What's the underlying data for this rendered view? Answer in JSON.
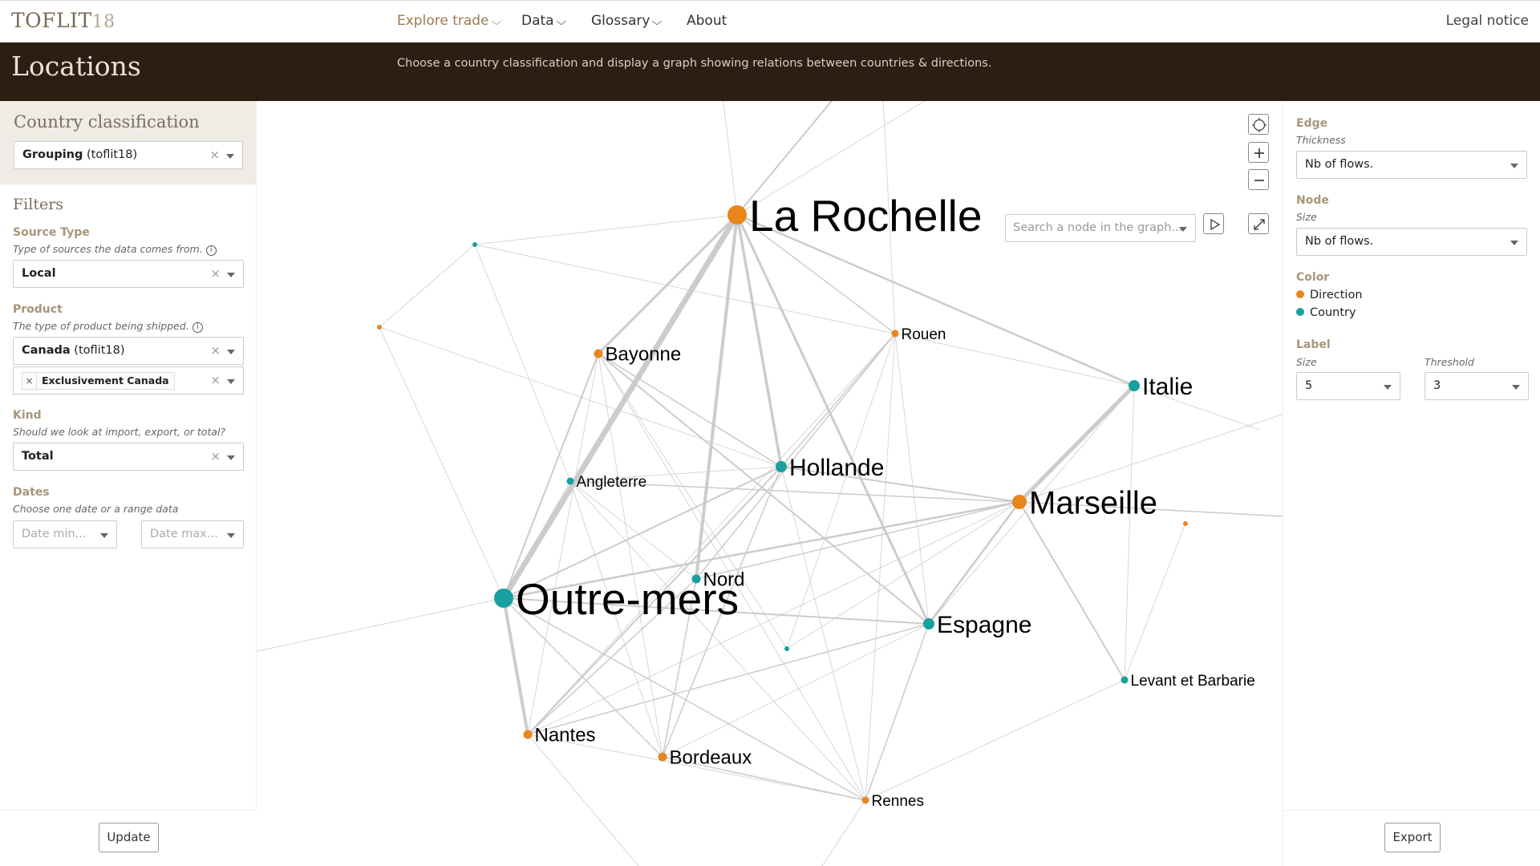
{
  "nav": {
    "logo_main": "TOFLIT",
    "logo_suffix": "18",
    "items": [
      {
        "label": "Explore trade"
      },
      {
        "label": "Data"
      },
      {
        "label": "Glossary"
      },
      {
        "label": "About"
      }
    ],
    "legal": "Legal notice"
  },
  "header": {
    "title": "Locations",
    "description": "Choose a country classification and display a graph showing relations between countries & directions."
  },
  "left": {
    "classification_title": "Country classification",
    "classification_value_bold": "Grouping",
    "classification_value_rest": " (toflit18)",
    "filters_title": "Filters",
    "source_type": {
      "label": "Source Type",
      "help": "Type of sources the data comes from.",
      "value": "Local"
    },
    "product": {
      "label": "Product",
      "help": "The type of product being shipped.",
      "value_bold": "Canada",
      "value_rest": " (toflit18)",
      "tag": "Exclusivement Canada"
    },
    "kind": {
      "label": "Kind",
      "help": "Should we look at import, export, or total?",
      "value": "Total"
    },
    "dates": {
      "label": "Dates",
      "help": "Choose one date or a range data",
      "min_placeholder": "Date min...",
      "max_placeholder": "Date max..."
    },
    "clear_symbol": "×",
    "update_label": "Update"
  },
  "graph": {
    "search_placeholder": "Search a node in the graph...",
    "nodes": [
      {
        "name": "La Rochelle",
        "type": "Direction",
        "label": true,
        "size": "xl"
      },
      {
        "name": "Outre-mers",
        "type": "Country",
        "label": true,
        "size": "xl"
      },
      {
        "name": "Marseille",
        "type": "Direction",
        "label": true,
        "size": "l"
      },
      {
        "name": "Hollande",
        "type": "Country",
        "label": true,
        "size": "m"
      },
      {
        "name": "Espagne",
        "type": "Country",
        "label": true,
        "size": "m"
      },
      {
        "name": "Italie",
        "type": "Country",
        "label": true,
        "size": "m"
      },
      {
        "name": "Nord",
        "type": "Country",
        "label": true,
        "size": "s"
      },
      {
        "name": "Nantes",
        "type": "Direction",
        "label": true,
        "size": "s"
      },
      {
        "name": "Bordeaux",
        "type": "Direction",
        "label": true,
        "size": "s"
      },
      {
        "name": "Bayonne",
        "type": "Direction",
        "label": true,
        "size": "s"
      },
      {
        "name": "Rennes",
        "type": "Direction",
        "label": true,
        "size": "xs"
      },
      {
        "name": "Rouen",
        "type": "Direction",
        "label": true,
        "size": "xs"
      },
      {
        "name": "Angleterre",
        "type": "Country",
        "label": true,
        "size": "xs"
      },
      {
        "name": "Levant et Barbarie",
        "type": "Country",
        "label": true,
        "size": "xs"
      },
      {
        "name": "",
        "type": "Country",
        "label": false,
        "size": "xxs"
      },
      {
        "name": "",
        "type": "Direction",
        "label": false,
        "size": "xxs"
      },
      {
        "name": "",
        "type": "Country",
        "label": false,
        "size": "xxs"
      },
      {
        "name": "",
        "type": "Direction",
        "label": false,
        "size": "xxs"
      }
    ]
  },
  "right": {
    "edge_label": "Edge",
    "edge_thickness_label": "Thickness",
    "edge_thickness_value": "Nb of flows.",
    "node_label": "Node",
    "node_size_label": "Size",
    "node_size_value": "Nb of flows.",
    "color_label": "Color",
    "legend": [
      {
        "name": "Direction",
        "color": "#e8861c"
      },
      {
        "name": "Country",
        "color": "#17a0a0"
      }
    ],
    "label_label": "Label",
    "label_size_label": "Size",
    "label_size_value": "5",
    "threshold_label": "Threshold",
    "threshold_value": "3",
    "export_label": "Export"
  },
  "colors": {
    "direction": "#e8861c",
    "country": "#17a0a0",
    "edge": "#c9c9c9"
  }
}
